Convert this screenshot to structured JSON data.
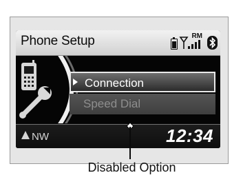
{
  "screen": {
    "title": "Phone Setup",
    "status": {
      "battery_icon": "battery-icon",
      "signal_icon": "signal-strength-icon",
      "roaming_label": "RM",
      "bluetooth_icon": "bluetooth-icon",
      "bluetooth_glyph": "ʙ"
    },
    "side_icon": "phone-settings-icon",
    "menu": {
      "items": [
        {
          "label": "Connection",
          "state": "selected"
        },
        {
          "label": "Speed Dial",
          "state": "disabled"
        }
      ]
    },
    "compass": {
      "label": "NW",
      "icon": "compass-arrow-icon"
    },
    "clock": "12:34"
  },
  "callout": {
    "label": "Disabled Option"
  },
  "colors": {
    "screen_bg": "#0a0a0a",
    "title_bar": "#e0e0e0",
    "selected_border": "#e9e9e9",
    "disabled_text": "#8e8e8e"
  }
}
